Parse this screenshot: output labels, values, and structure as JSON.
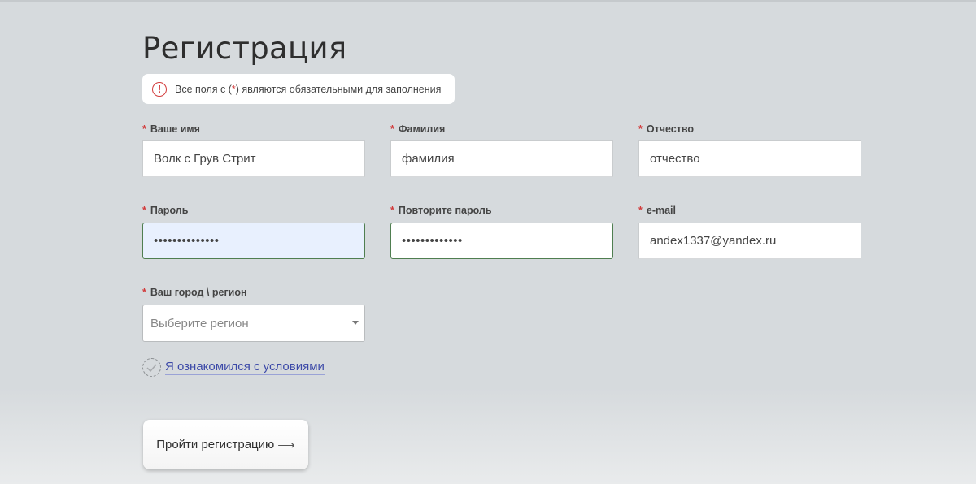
{
  "page": {
    "title": "Регистрация"
  },
  "notice": {
    "icon": "exclamation-icon",
    "text_before": "Все поля с (",
    "asterisk": " * ",
    "text_after": ") являются обязательными для заполнения"
  },
  "form": {
    "required_mark": "*",
    "first_name": {
      "label": "Ваше имя",
      "value": "Волк с Грув Стрит"
    },
    "last_name": {
      "label": "Фамилия",
      "placeholder": "фамилия"
    },
    "middle_name": {
      "label": "Отчество",
      "placeholder": "отчество"
    },
    "password": {
      "label": "Пароль",
      "masked": "••••••••••••••"
    },
    "password_repeat": {
      "label": "Повторите пароль",
      "masked": "•••••••••••••"
    },
    "email": {
      "label": "e-mail",
      "value": "andex1337@yandex.ru"
    },
    "region": {
      "label": "Ваш город \\ регион",
      "placeholder": "Выберите регион"
    },
    "terms": {
      "label": "Я ознакомился с условиями",
      "checked": false
    },
    "submit": {
      "label": "Пройти регистрацию",
      "arrow": "⟶"
    }
  },
  "colors": {
    "required": "#d23b3b",
    "link": "#3d4aa8",
    "focus_border": "#4f7e50",
    "autofill_bg": "#e8f0fe"
  }
}
